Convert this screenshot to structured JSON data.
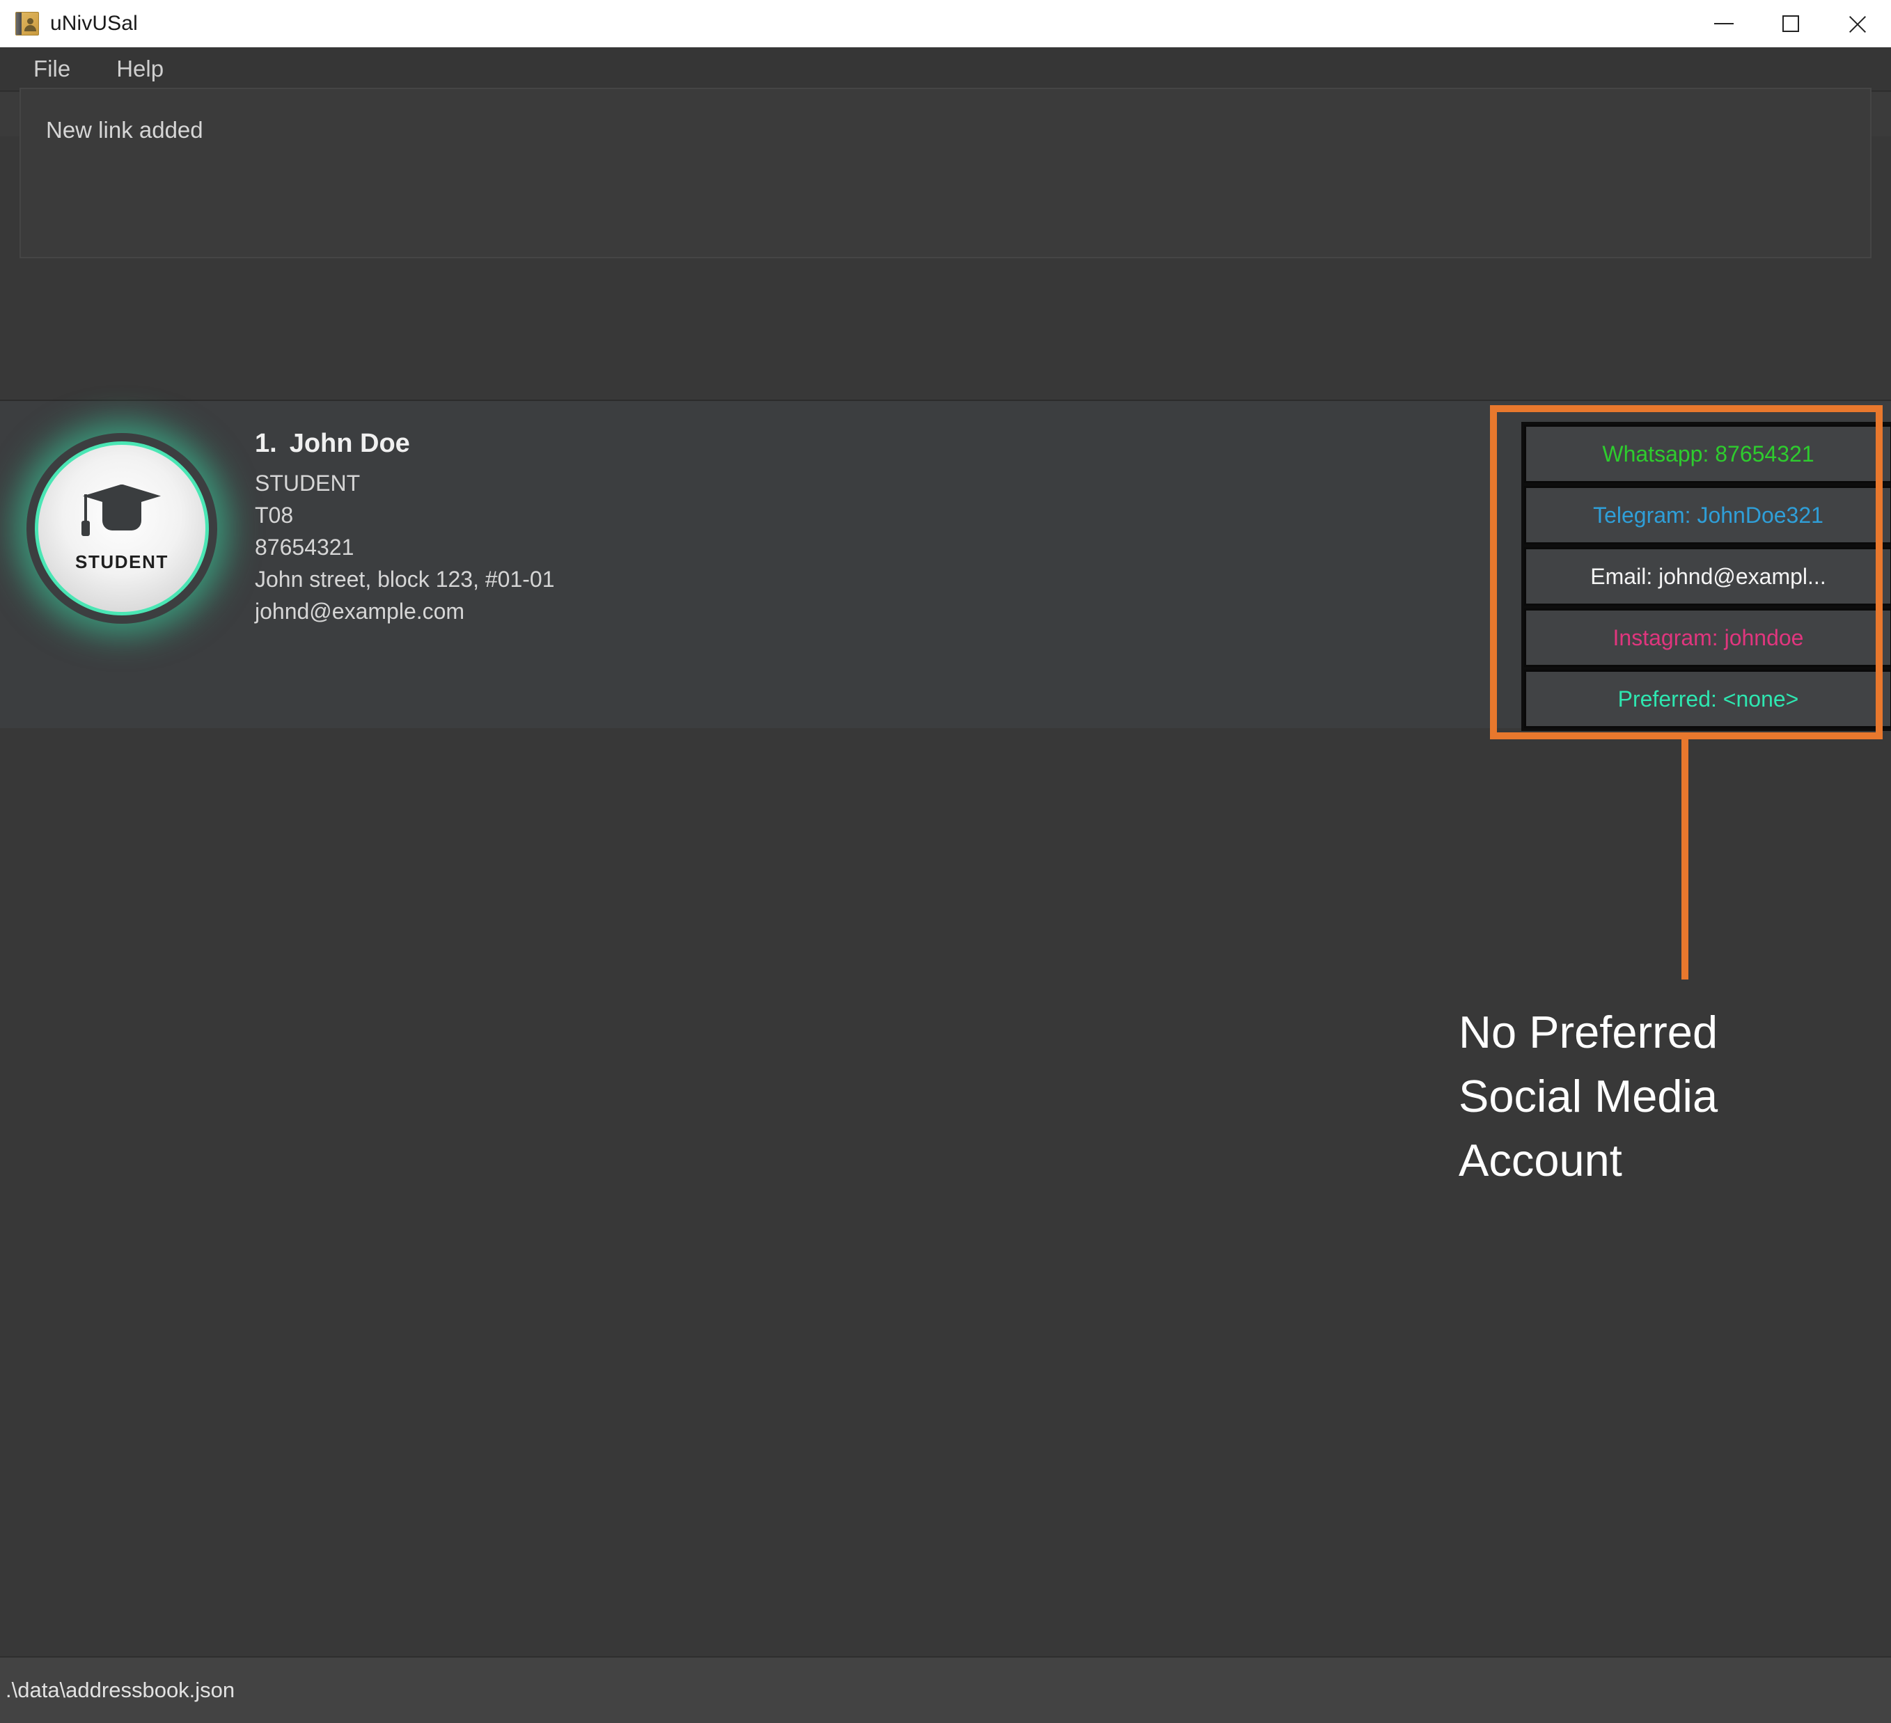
{
  "window": {
    "title": "uNivUSal",
    "icon": "address-book-icon",
    "controls": {
      "minimize": "minimize-icon",
      "maximize": "maximize-icon",
      "close": "close-icon"
    }
  },
  "menu": {
    "items": [
      {
        "label": "File"
      },
      {
        "label": "Help"
      }
    ]
  },
  "command": {
    "value": "",
    "placeholder": ""
  },
  "result": {
    "message": "New link added"
  },
  "person": {
    "index": "1.",
    "name": "John Doe",
    "avatar_label": "STUDENT",
    "avatar_icon": "graduation-cap-icon",
    "avatar_ring_color": "#4ae6b4",
    "details": [
      "STUDENT",
      "T08",
      "87654321",
      "John street, block 123, #01-01",
      "johnd@example.com"
    ],
    "links": [
      {
        "label": "Whatsapp: 87654321",
        "color": "#2ecc2e"
      },
      {
        "label": "Telegram: JohnDoe321",
        "color": "#2f9fd8"
      },
      {
        "label": "Email: johnd@exampl...",
        "color": "#f4f4f4"
      },
      {
        "label": "Instagram: johndoe",
        "color": "#e0367e"
      },
      {
        "label": "Preferred: <none>",
        "color": "#2ee6b0"
      }
    ]
  },
  "annotation": {
    "color": "#e8782d",
    "lines": [
      "No Preferred",
      "Social Media",
      "Account"
    ]
  },
  "status": {
    "path": ".\\data\\addressbook.json"
  }
}
